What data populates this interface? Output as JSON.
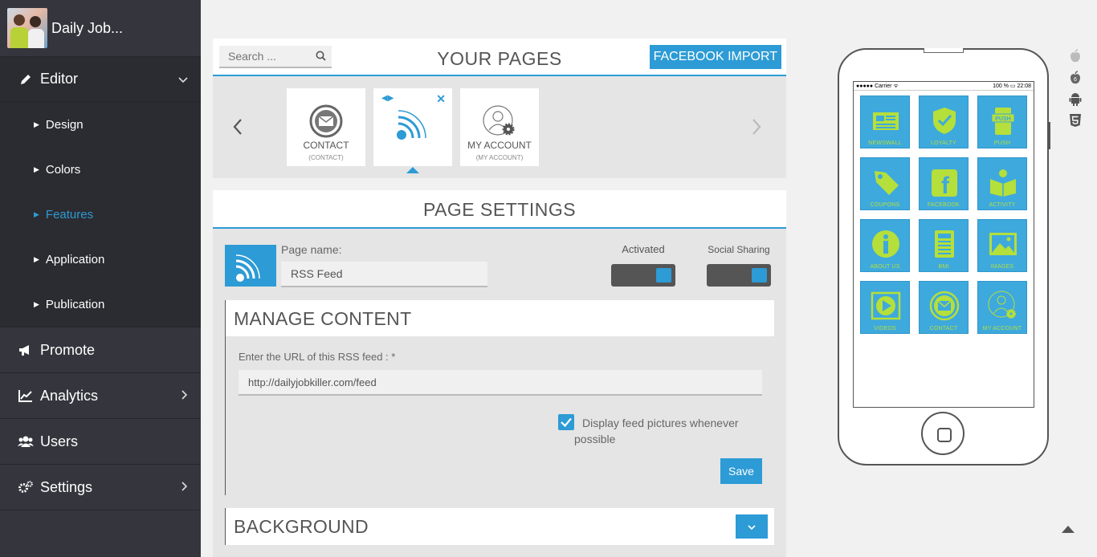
{
  "app": {
    "title": "Daily Job..."
  },
  "sidebar": {
    "editor": "Editor",
    "sub_items": [
      {
        "label": "Design"
      },
      {
        "label": "Colors"
      },
      {
        "label": "Features"
      },
      {
        "label": "Application"
      },
      {
        "label": "Publication"
      }
    ],
    "promote": "Promote",
    "analytics": "Analytics",
    "users": "Users",
    "settings": "Settings"
  },
  "pages_panel": {
    "search_placeholder": "Search ...",
    "title": "YOUR PAGES",
    "facebook_import": "FACEBOOK IMPORT",
    "cards": [
      {
        "label": "CONTACT",
        "sub": "(CONTACT)"
      },
      {
        "label": "",
        "sub": ""
      },
      {
        "label": "MY ACCOUNT",
        "sub": "(MY ACCOUNT)"
      }
    ]
  },
  "page_settings": {
    "title": "PAGE SETTINGS",
    "page_name_label": "Page name:",
    "page_name_value": "RSS Feed",
    "activated_label": "Activated",
    "social_sharing_label": "Social Sharing",
    "activated": true,
    "social_sharing": true
  },
  "manage_content": {
    "title": "MANAGE CONTENT",
    "url_label": "Enter the URL of this RSS feed : *",
    "url_value": "http://dailyjobkiller.com/feed",
    "checkbox_label": "Display feed pictures whenever possible",
    "checkbox_checked": true,
    "save": "Save"
  },
  "background": {
    "title": "BACKGROUND"
  },
  "phone": {
    "carrier": "●●●●● Carrier ᯤ",
    "status_right": "100 % ▭ 22:08",
    "tiles": [
      {
        "label": "NEWSWALL",
        "icon": "newspaper-icon"
      },
      {
        "label": "LOYALTY",
        "icon": "shield-check-icon"
      },
      {
        "label": "PUSH",
        "icon": "push-icon"
      },
      {
        "label": "COUPONS",
        "icon": "tag-icon"
      },
      {
        "label": "FACEBOOK",
        "icon": "facebook-icon"
      },
      {
        "label": "ACTIVITY",
        "icon": "reader-icon"
      },
      {
        "label": "ABOUT US",
        "icon": "info-icon"
      },
      {
        "label": "BMI",
        "icon": "calculator-icon"
      },
      {
        "label": "IMAGES",
        "icon": "image-icon"
      },
      {
        "label": "VIDEOS",
        "icon": "play-icon"
      },
      {
        "label": "CONTACT",
        "icon": "mail-icon"
      },
      {
        "label": "MY ACCOUNT",
        "icon": "account-icon"
      }
    ]
  },
  "colors": {
    "accent": "#2d9bd5",
    "sidebar": "#35363d",
    "tile": "#3ea9dd",
    "tile_label": "#b5df3a"
  }
}
